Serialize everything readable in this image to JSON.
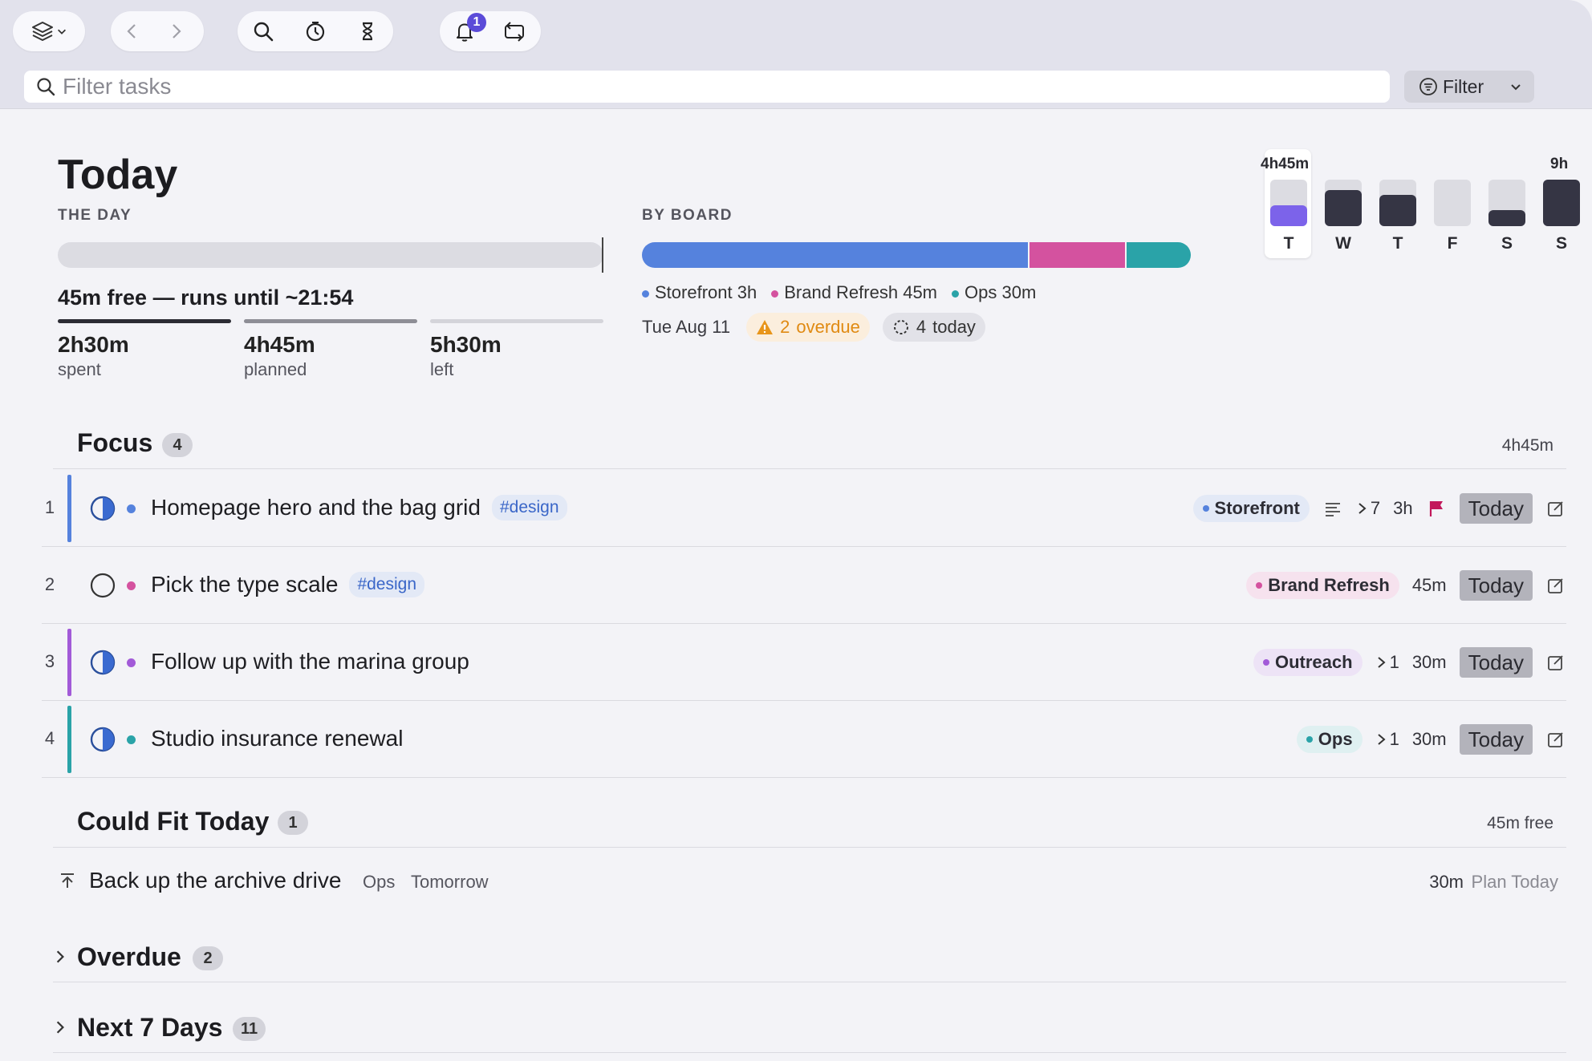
{
  "toolbar": {
    "notification_count": "1"
  },
  "search": {
    "placeholder": "Filter tasks",
    "filter_label": "Filter"
  },
  "header": {
    "title": "Today",
    "day_label": "THE DAY",
    "board_label": "BY BOARD",
    "free_text": "45m free — runs until ~21:54",
    "stats": [
      {
        "value": "2h30m",
        "label": "spent"
      },
      {
        "value": "4h45m",
        "label": "planned"
      },
      {
        "value": "5h30m",
        "label": "left"
      }
    ],
    "boards": [
      {
        "name": "Storefront",
        "time": "3h",
        "minutes": 180,
        "color": "#5582dd"
      },
      {
        "name": "Brand Refresh",
        "time": "45m",
        "minutes": 45,
        "color": "#d4529f"
      },
      {
        "name": "Ops",
        "time": "30m",
        "minutes": 30,
        "color": "#2aa3a8"
      }
    ],
    "date": "Tue Aug 11",
    "overdue_count": "2",
    "overdue_label": "overdue",
    "today_count": "4",
    "today_label": "today"
  },
  "week": {
    "selected_total": "4h45m",
    "max_label": "9h",
    "days": [
      {
        "label": "T",
        "level": 0.45,
        "color": "#7c63ea",
        "selected": true
      },
      {
        "label": "W",
        "level": 0.78,
        "color": "#353544",
        "selected": false
      },
      {
        "label": "T",
        "level": 0.68,
        "color": "#353544",
        "selected": false
      },
      {
        "label": "F",
        "level": 0.0,
        "color": "#353544",
        "selected": false
      },
      {
        "label": "S",
        "level": 0.35,
        "color": "#353544",
        "selected": false
      },
      {
        "label": "S",
        "level": 1.0,
        "color": "#353544",
        "selected": false
      }
    ]
  },
  "focus": {
    "title": "Focus",
    "count": "4",
    "total": "4h45m",
    "tasks": [
      {
        "num": "1",
        "title": "Homepage hero and the bag grid",
        "tag": "#design",
        "board": "Storefront",
        "board_color": "#5582dd",
        "chip_bg": "#e3e9f6",
        "accent": "#5582dd",
        "dot": "#5582dd",
        "state": "half",
        "has_notes": true,
        "subtasks": "7",
        "duration": "3h",
        "flagged": true,
        "day": "Today"
      },
      {
        "num": "2",
        "title": "Pick the type scale",
        "tag": "#design",
        "board": "Brand Refresh",
        "board_color": "#d4529f",
        "chip_bg": "#f6e2ee",
        "accent": "",
        "dot": "#d4529f",
        "state": "empty",
        "has_notes": false,
        "subtasks": "",
        "duration": "45m",
        "flagged": false,
        "day": "Today"
      },
      {
        "num": "3",
        "title": "Follow up with the marina group",
        "tag": "",
        "board": "Outreach",
        "board_color": "#a25ad8",
        "chip_bg": "#ede3f6",
        "accent": "#a25ad8",
        "dot": "#a25ad8",
        "state": "half",
        "has_notes": false,
        "subtasks": "1",
        "duration": "30m",
        "flagged": false,
        "day": "Today"
      },
      {
        "num": "4",
        "title": "Studio insurance renewal",
        "tag": "",
        "board": "Ops",
        "board_color": "#2aa3a8",
        "chip_bg": "#dff0f1",
        "accent": "#2aa3a8",
        "dot": "#2aa3a8",
        "state": "half",
        "has_notes": false,
        "subtasks": "1",
        "duration": "30m",
        "flagged": false,
        "day": "Today"
      }
    ]
  },
  "could_fit": {
    "title": "Could Fit Today",
    "count": "1",
    "meta": "45m free",
    "task": {
      "title": "Back up the archive drive",
      "board": "Ops",
      "when": "Tomorrow",
      "duration": "30m",
      "action": "Plan Today"
    }
  },
  "overdue": {
    "title": "Overdue",
    "count": "2"
  },
  "next7": {
    "title": "Next 7 Days",
    "count": "11"
  }
}
